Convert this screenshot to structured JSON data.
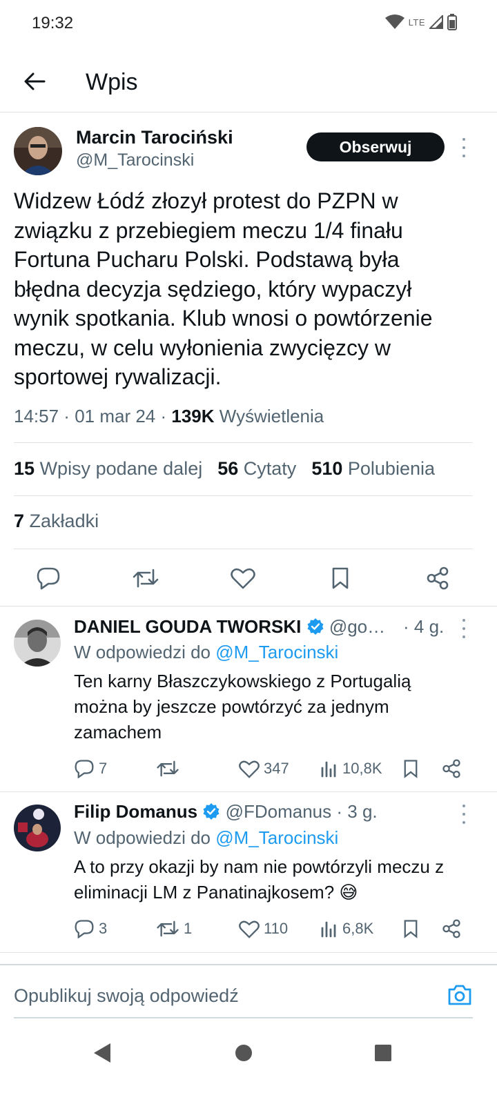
{
  "status_bar": {
    "time": "19:32",
    "network": "LTE"
  },
  "header": {
    "title": "Wpis",
    "back_icon": "arrow-left-icon"
  },
  "main_tweet": {
    "author_name": "Marcin Tarociński",
    "author_handle": "@M_Tarocinski",
    "follow_label": "Obserwuj",
    "text": "Widzew Łódź złozył protest do PZPN w\nzwiązku z przebiegiem meczu 1/4 finału\nFortuna Pucharu Polski. Podstawą była\nbłędna decyzja sędziego, który wypaczył\nwynik spotkania. Klub wnosi o powtórzenie\nmeczu, w celu wyłonienia zwycięzcy w\nsportowej rywalizacji.",
    "time": "14:57",
    "date": "01 mar 24",
    "views_count": "139K",
    "views_label": "Wyświetlenia",
    "stats": {
      "retweets_count": "15",
      "retweets_label": "Wpisy podane dalej",
      "quotes_count": "56",
      "quotes_label": "Cytaty",
      "likes_count": "510",
      "likes_label": "Polubienia",
      "bookmarks_count": "7",
      "bookmarks_label": "Zakładki"
    }
  },
  "replies": [
    {
      "name": "DANIEL GOUDA TWORSKI",
      "handle": "@go…",
      "time": "· 4 g.",
      "verified": true,
      "reply_to_label": "W odpowiedzi do",
      "reply_to_handle": "@M_Tarocinski",
      "text": "Ten karny Błaszczykowskiego z Portugalią\nmożna by jeszcze powtórzyć za jednym\nzamachem",
      "replies_count": "7",
      "retweets_count": "",
      "likes_count": "347",
      "views_count": "10,8K"
    },
    {
      "name": "Filip Domanus",
      "handle": "@FDomanus",
      "time": "· 3 g.",
      "verified": true,
      "reply_to_label": "W odpowiedzi do",
      "reply_to_handle": "@M_Tarocinski",
      "text": "A to przy okazji by nam nie powtórzyli meczu z\neliminacji LM z Panatinajkosem? 😅",
      "replies_count": "3",
      "retweets_count": "1",
      "likes_count": "110",
      "views_count": "6,8K"
    }
  ],
  "compose": {
    "placeholder": "Opublikuj swoją odpowiedź"
  },
  "colors": {
    "accent": "#1d9bf0",
    "text": "#0f1419",
    "muted": "#536471"
  }
}
